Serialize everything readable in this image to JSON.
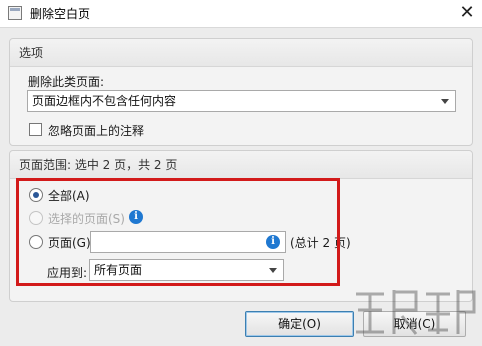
{
  "window": {
    "title": "删除空白页",
    "close_glyph": "✕"
  },
  "options_group": {
    "header": "选项",
    "delete_type_label": "删除此类页面:",
    "delete_type_value": "页面边框内不包含任何内容",
    "ignore_annotations_label": "忽略页面上的注释",
    "ignore_annotations_checked": false
  },
  "range_group": {
    "header": "页面范围: 选中 2 页，共 2 页",
    "all_label": "全部(A)",
    "all_selected": true,
    "selected_pages_label": "选择的页面(S)",
    "pages_label": "页面(G)",
    "pages_input_value": "",
    "total_text": "(总计 2 页)",
    "apply_to_label": "应用到:",
    "apply_to_value": "所有页面"
  },
  "buttons": {
    "ok": "确定(O)",
    "cancel": "取消(C)"
  },
  "icons": {
    "app": "document-icon",
    "info": "info-icon",
    "close": "close-icon"
  },
  "colors": {
    "highlight_box": "#d21a1a",
    "info_icon": "#1f78d1",
    "radio_dot": "#2b5797"
  }
}
